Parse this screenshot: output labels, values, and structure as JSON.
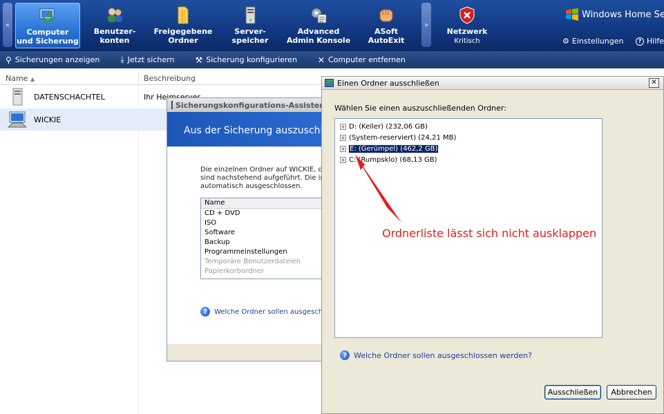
{
  "topbar": {
    "tabs": [
      {
        "line1": "Computer",
        "line2": "und Sicherung",
        "icon": "computer-backup-icon"
      },
      {
        "line1": "Benutzer-",
        "line2": "konten",
        "icon": "users-icon"
      },
      {
        "line1": "Freigegebene",
        "line2": "Ordner",
        "icon": "folder-icon"
      },
      {
        "line1": "Server-",
        "line2": "speicher",
        "icon": "server-storage-icon"
      },
      {
        "line1": "Advanced",
        "line2": "Admin Konsole",
        "icon": "admin-console-icon"
      },
      {
        "line1": "ASoft",
        "line2": "AutoExit",
        "icon": "fist-icon"
      },
      {
        "line1": "Netzwerk",
        "line2": "Kritisch",
        "icon": "network-critical-icon"
      }
    ],
    "scroll_left": "«",
    "scroll_right": "»",
    "brand": "Windows Home Serv",
    "settings_label": "Einstellungen",
    "help_label": "Hilfe"
  },
  "toolbar": {
    "items": [
      {
        "label": "Sicherungen anzeigen",
        "icon": "view-backups-icon"
      },
      {
        "label": "Jetzt sichern",
        "icon": "backup-now-icon"
      },
      {
        "label": "Sicherung konfigurieren",
        "icon": "configure-backup-icon"
      },
      {
        "label": "Computer entfernen",
        "icon": "remove-icon"
      }
    ]
  },
  "computer_list": {
    "col_name": "Name",
    "col_description": "Beschreibung",
    "rows": [
      {
        "name": "DATENSCHACHTEL",
        "description": "Ihr Heimserver",
        "selected": false
      },
      {
        "name": "WICKIE",
        "description": "",
        "selected": true
      }
    ]
  },
  "wizard": {
    "title": "Sicherungskonfigurations-Assistent",
    "banner": "Aus der Sicherung auszuschlie",
    "desc_line1": "Die einzelnen Ordner auf WICKIE, di",
    "desc_line2": "sind nachstehend aufgeführt. Die in",
    "desc_line3": "automatisch ausgeschlossen.",
    "list_header": "Name",
    "items": [
      {
        "label": "CD + DVD",
        "dim": false
      },
      {
        "label": "ISO",
        "dim": false
      },
      {
        "label": "Software",
        "dim": false
      },
      {
        "label": "Backup",
        "dim": false
      },
      {
        "label": "Programmeinstellungen",
        "dim": false
      },
      {
        "label": "Temporäre Benutzerdateien",
        "dim": true
      },
      {
        "label": "Papierkorbordner",
        "dim": true
      }
    ],
    "help_link": "Welche Ordner sollen ausgeschl"
  },
  "dialog": {
    "title": "Einen Ordner ausschließen",
    "close": "✕",
    "prompt": "Wählen Sie einen auszuschließenden Ordner:",
    "tree": [
      {
        "label": "D: (Keller) (232,06 GB)",
        "expander": "+",
        "selected": false
      },
      {
        "label": "(System-reserviert) (24,21 MB)",
        "expander": "+",
        "selected": false
      },
      {
        "label": "E: (Gerümpel) (462,2 GB)",
        "expander": "+",
        "selected": true
      },
      {
        "label": "C: (Rumpsklo) (68,13 GB)",
        "expander": "+",
        "selected": false
      }
    ],
    "help_link": "Welche Ordner sollen ausgeschlossen werden?",
    "ok_button": "Ausschließen",
    "cancel_button": "Abbrechen"
  },
  "annotation": {
    "text": "Ordnerliste lässt sich nicht ausklappen",
    "color": "#e51c1c"
  }
}
